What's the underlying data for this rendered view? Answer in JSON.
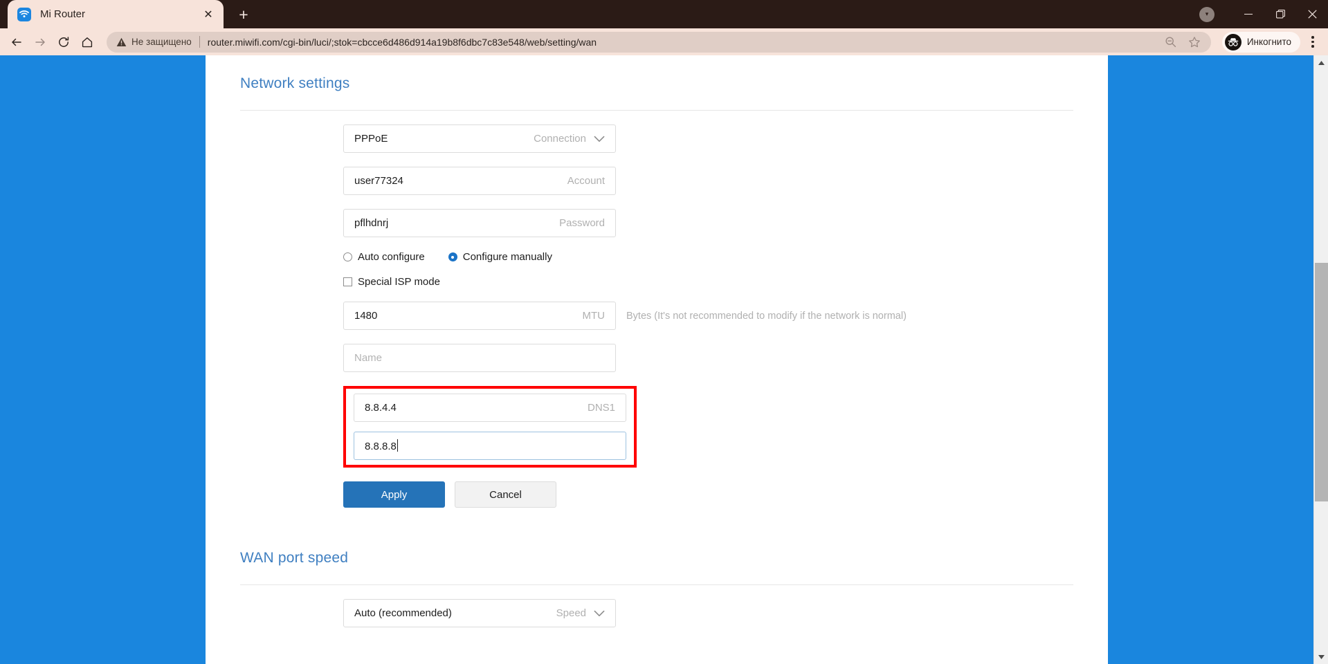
{
  "browser": {
    "tab": {
      "title": "Mi Router",
      "favicon": "wifi-icon",
      "close": "✕"
    },
    "new_tab_label": "+",
    "window_controls": {
      "extra": "▾",
      "minimize": "—",
      "maximize": "❐",
      "close": "✕"
    },
    "toolbar": {
      "back": "←",
      "forward": "→",
      "reload": "⟳",
      "home": "⌂",
      "security_label": "Не защищено",
      "url": "router.miwifi.com/cgi-bin/luci/;stok=cbcce6d486d914a19b8f6dbc7c83e548/web/setting/wan",
      "zoom_icon": "zoom-out-icon",
      "bookmark_icon": "star-icon",
      "profile_label": "Инкогнито",
      "menu_icon": "kebab-menu-icon"
    }
  },
  "colors": {
    "page_background": "#1a86de",
    "heading": "#3f7fc1",
    "primary_button": "#2573b8",
    "highlight_box": "#ff0000",
    "focus_border": "#9dc2e0"
  },
  "page": {
    "network_settings": {
      "title": "Network settings",
      "connection": {
        "value": "PPPoE",
        "label": "Connection",
        "chevron": "chevron-down-icon"
      },
      "account": {
        "value": "user77324",
        "label": "Account"
      },
      "password": {
        "value": "pflhdnrj",
        "label": "Password"
      },
      "config_mode": {
        "auto": {
          "label": "Auto configure",
          "selected": false
        },
        "manual": {
          "label": "Configure manually",
          "selected": true
        }
      },
      "special_isp": {
        "label": "Special ISP mode",
        "checked": false
      },
      "mtu": {
        "value": "1480",
        "label": "MTU",
        "hint": "Bytes (It's not recommended to modify if the network is normal)"
      },
      "name": {
        "value": "",
        "placeholder": "Name"
      },
      "dns1": {
        "value": "8.8.4.4",
        "label": "DNS1"
      },
      "dns2": {
        "value": "8.8.8.8",
        "label": "",
        "focused": true
      },
      "apply_label": "Apply",
      "cancel_label": "Cancel"
    },
    "wan_port_speed": {
      "title": "WAN port speed",
      "speed": {
        "value": "Auto (recommended)",
        "label": "Speed",
        "chevron": "chevron-down-icon"
      }
    }
  }
}
